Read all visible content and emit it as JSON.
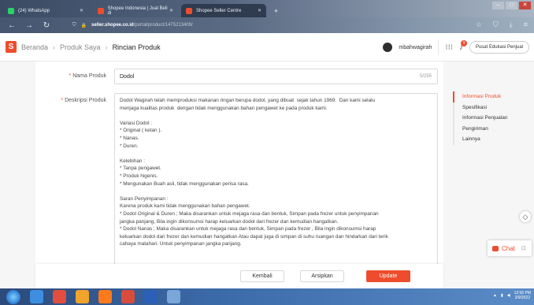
{
  "browser": {
    "tabs": [
      {
        "label": "(24) WhatsApp",
        "color": "#25d366"
      },
      {
        "label": "Shopee Indonesia | Jual Beli di",
        "color": "#ee4d2d"
      },
      {
        "label": "Shopee Seller Centre",
        "color": "#ee4d2d"
      }
    ],
    "url_host": "seller.shopee.co.id",
    "url_path": "/portal/product/1475213409/"
  },
  "header": {
    "logo_letter": "S",
    "breadcrumb": [
      "Beranda",
      "Produk Saya",
      "Rincian Produk"
    ],
    "username": "mbahwagirah",
    "notification_count": "9",
    "education_button": "Pusat Edukasi Penjual"
  },
  "form": {
    "name_label": "Nama Produk",
    "name_value": "Dodol",
    "name_count": "5/255",
    "desc_label": "Deskripsi Produk",
    "description": [
      "Dodol Wagirah telah memproduksi makanan ringan berupa dodol, yang dibuat  sejak tahun 1969.  Dan kami selalu",
      "menjaga kualitas produk  dengan tidak menggunakan bahan pengawet ke pada produk kami.",
      "",
      "Variasi Dodol :",
      "* Original ( ketan ).",
      "* Nanas.",
      "* Duren.",
      "",
      "Kelebihan :",
      "* Tanpa pengawet.",
      "* Produk higenis.",
      "* Mengunakan Buah asli, tidak menggunakan perisa rasa.",
      "",
      "Saran Penyimpanan :",
      "Karena produk kami tidak menggunakan bahan pengawet.",
      "* Dodol Original & Duren ; Maka disarankan untuk mejaga rasa dan bentuk, Simpan pada frezer untuk penyimpanan",
      "jangka panjang, Bila ingin dikonsumsi harap keluarkan dodol dari frezer dan kemudian hangatkan.",
      "* Dodol Nanas ; Maka disarankan untuk mejaga rasa dan bentuk, Simpan pada frezer , Bila ingin dikonsumsi harap",
      "keluarkan dodol dari frezer dan kemudian hangatkan Atau dapat juga di simpan di suhu ruangan dan hindarkan dari terik",
      "cahaya matahari. Untuk penyimpanan jangka panjang."
    ]
  },
  "sidenav": [
    "Informasi Produk",
    "Spesifikasi",
    "Informasi Penjualan",
    "Pengiriman",
    "Lainnya"
  ],
  "actions": {
    "back": "Kembali",
    "archive": "Arsipkan",
    "update": "Update"
  },
  "chat": {
    "label": "Chat"
  },
  "taskbar": {
    "time": "12:56 PM",
    "date": "3/9/2022"
  },
  "colors": {
    "accent": "#ee4d2d"
  }
}
